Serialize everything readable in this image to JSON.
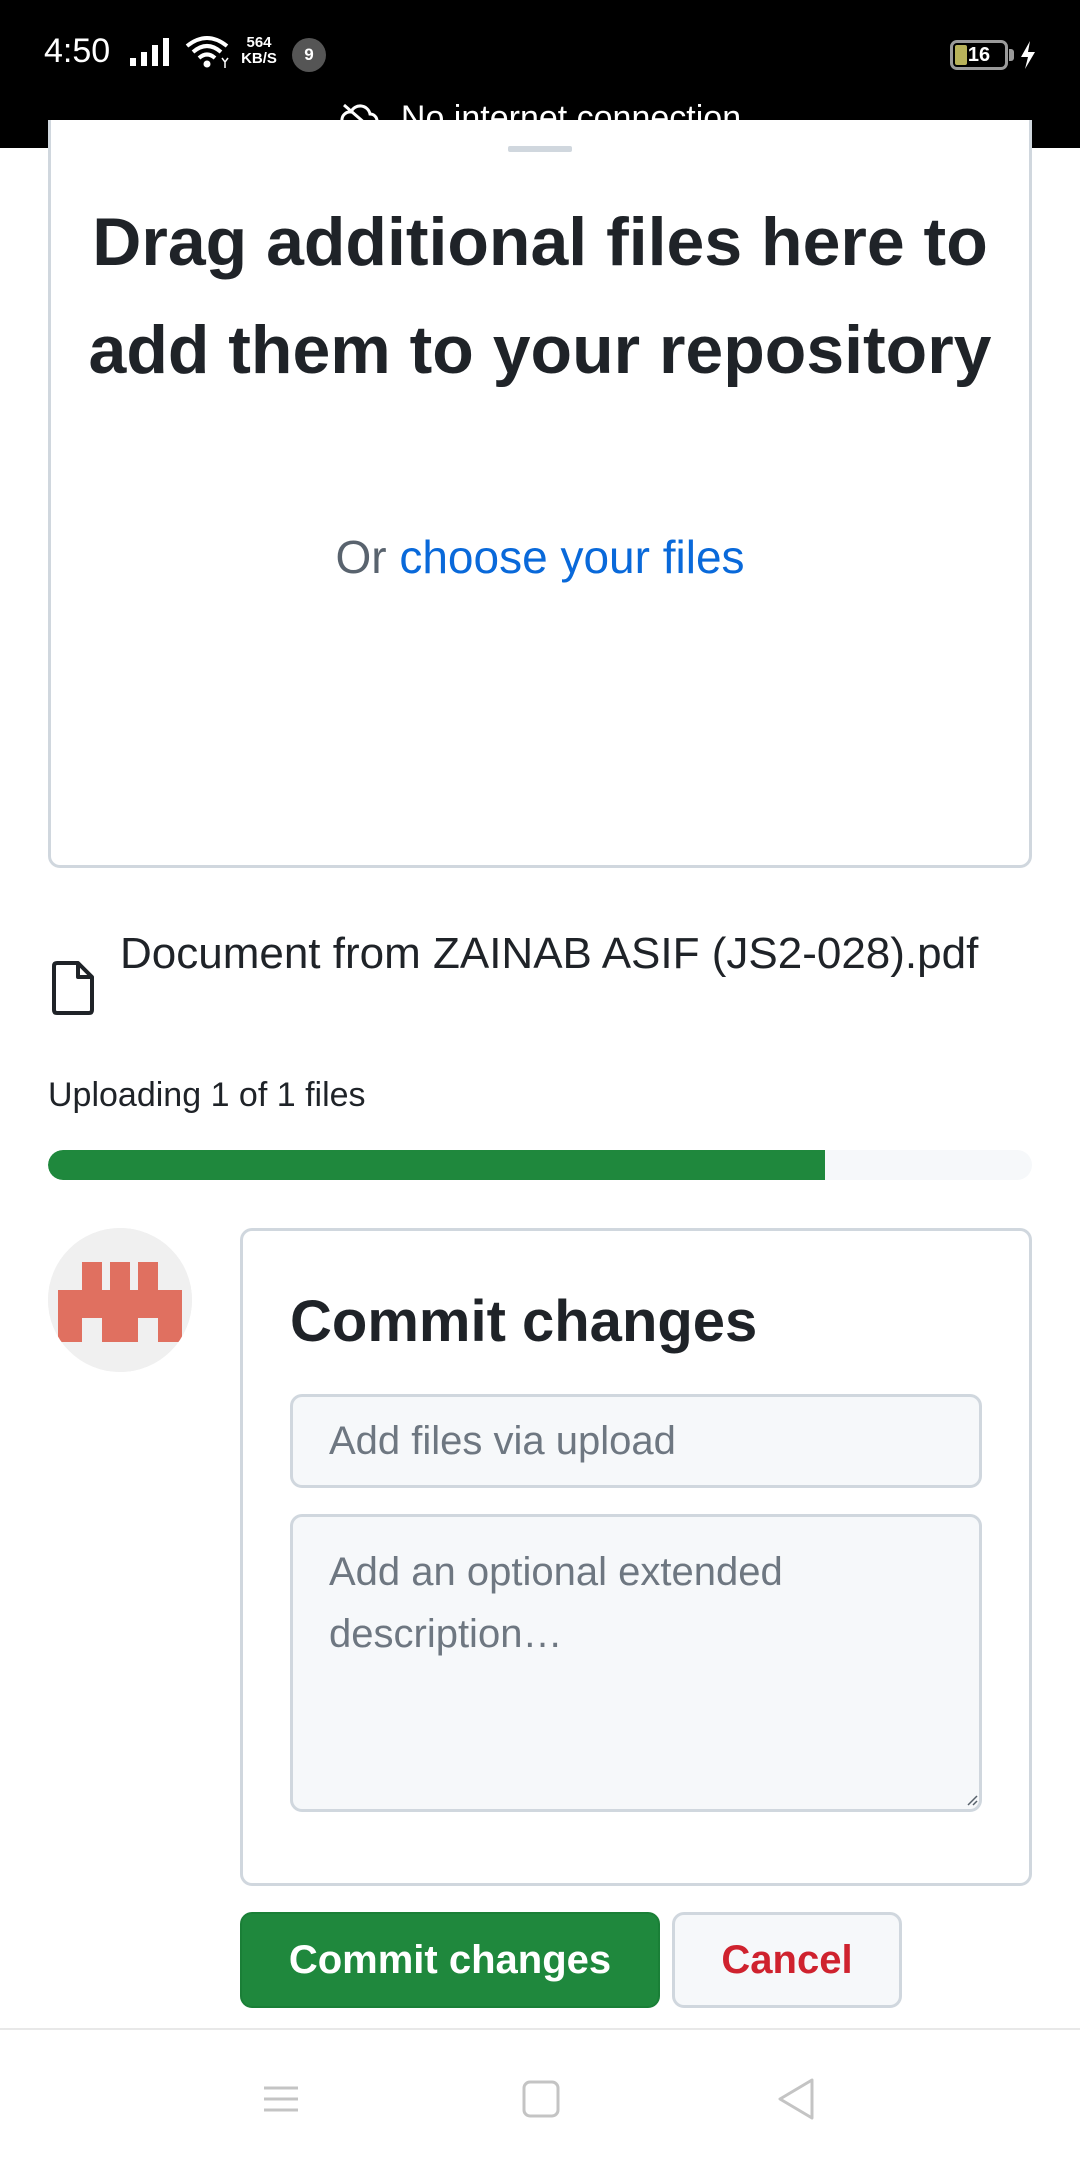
{
  "status_bar": {
    "time": "4:50",
    "net_speed_value": "564",
    "net_speed_unit": "KB/S",
    "notification_count": "9",
    "battery_level": "16"
  },
  "offline_banner": {
    "text": "No internet connection"
  },
  "dropzone": {
    "title": "Drag additional files here to add them to your repository",
    "or_text": "Or ",
    "choose_link": "choose your files"
  },
  "upload": {
    "file_name": "Document from ZAINAB ASIF (JS2-028).pdf",
    "status_text": "Uploading 1 of 1 files",
    "progress": 0.79
  },
  "commit": {
    "title": "Commit changes",
    "summary_placeholder": "Add files via upload",
    "description_placeholder": "Add an optional extended description…",
    "commit_button": "Commit changes",
    "cancel_button": "Cancel"
  },
  "colors": {
    "primary_green": "#1f883d",
    "link_blue": "#0969da",
    "danger_red": "#cf222e",
    "avatar_coral": "#e07060"
  },
  "icons": {
    "file": "file-icon",
    "offline": "cloud-off-icon",
    "nav_menu": "menu-icon",
    "nav_home": "home-square-icon",
    "nav_back": "back-triangle-icon"
  }
}
